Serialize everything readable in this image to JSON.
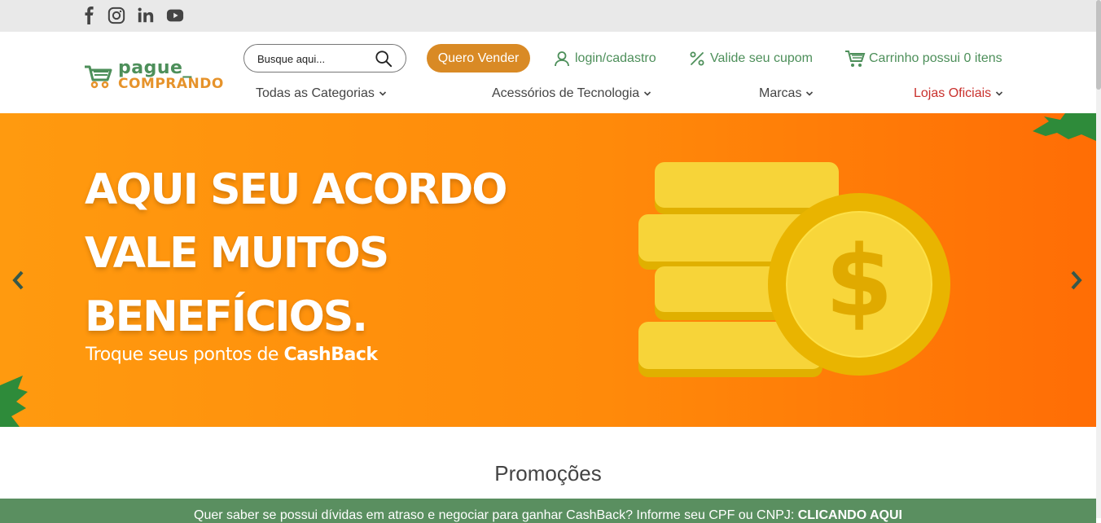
{
  "social": {
    "facebook": "facebook-icon",
    "instagram": "instagram-icon",
    "linkedin": "linkedin-icon",
    "youtube": "youtube-icon"
  },
  "logo": {
    "line1": "pague_",
    "line2": "COMPRANDO"
  },
  "search": {
    "placeholder": "Busque aqui..."
  },
  "header": {
    "sell_label": "Quero Vender",
    "login_label": "login/cadastro",
    "coupon_label": "Valide seu cupom",
    "cart_label": "Carrinho possui 0 itens"
  },
  "nav": {
    "categories": "Todas as Categorias",
    "tech": "Acessórios de Tecnologia",
    "brands": "Marcas",
    "stores": "Lojas Oficiais"
  },
  "banner": {
    "line1": "AQUI SEU ACORDO",
    "line2": "VALE MUITOS",
    "line3": "BENEFÍCIOS.",
    "sub_text": "Troque seus pontos de ",
    "sub_bold": "CashBack"
  },
  "section": {
    "title": "Promoções"
  },
  "notice": {
    "text": "Quer saber se possui dívidas em atraso e negociar para ganhar CashBack? Informe seu CPF ou CNPJ: ",
    "link": "CLICANDO AQUI"
  },
  "colors": {
    "brand_green": "#4d8f5a",
    "brand_orange": "#d98a25",
    "banner_orange": "#ff8a0a",
    "notice_green": "#5a8f60",
    "stores_red": "#c9302c"
  }
}
